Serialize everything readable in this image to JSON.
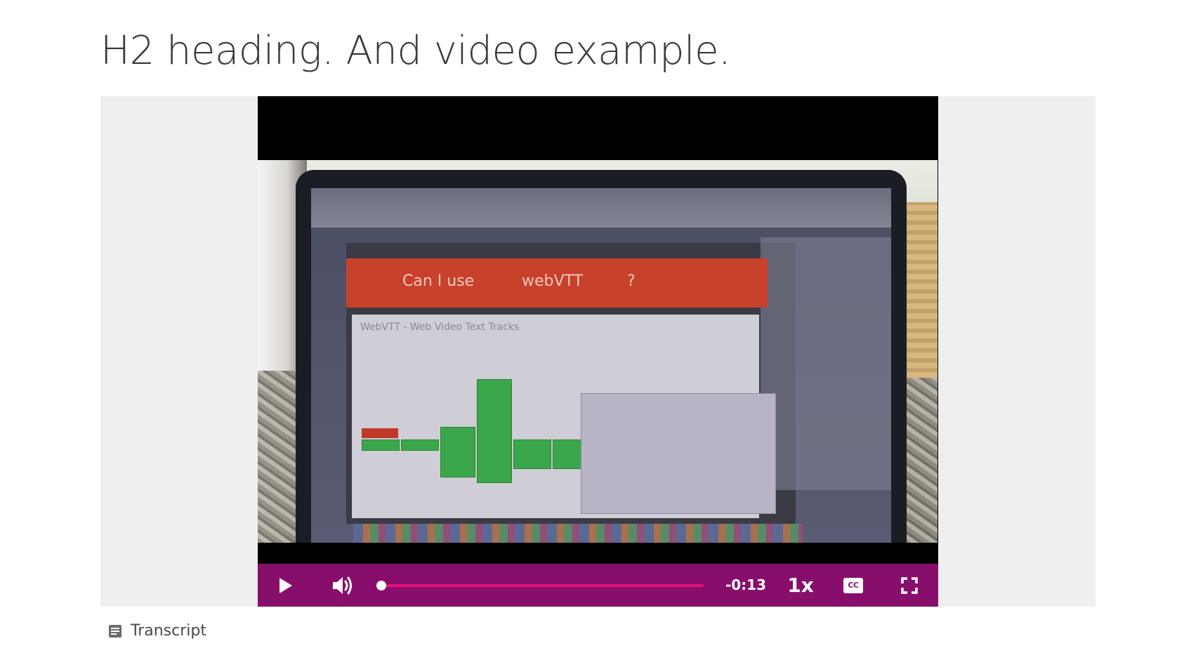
{
  "page": {
    "heading": "H2 heading. And video example."
  },
  "video": {
    "screen_text": {
      "can_i_use": "Can I use",
      "query": "webVTT",
      "question_mark": "?",
      "feature_title": "WebVTT - Web Video Text Tracks"
    },
    "controls": {
      "play_icon": "play-icon",
      "volume_icon": "volume-icon",
      "progress_fraction": 0.0,
      "time_remaining": "-0:13",
      "speed": "1x",
      "captions_label": "CC",
      "fullscreen_icon": "fullscreen-icon"
    },
    "colors": {
      "control_bar": "#880e6c",
      "progress_track": "#e2137b",
      "background_panel": "#efefef"
    }
  },
  "transcript": {
    "icon": "document-icon",
    "label": "Transcript"
  }
}
